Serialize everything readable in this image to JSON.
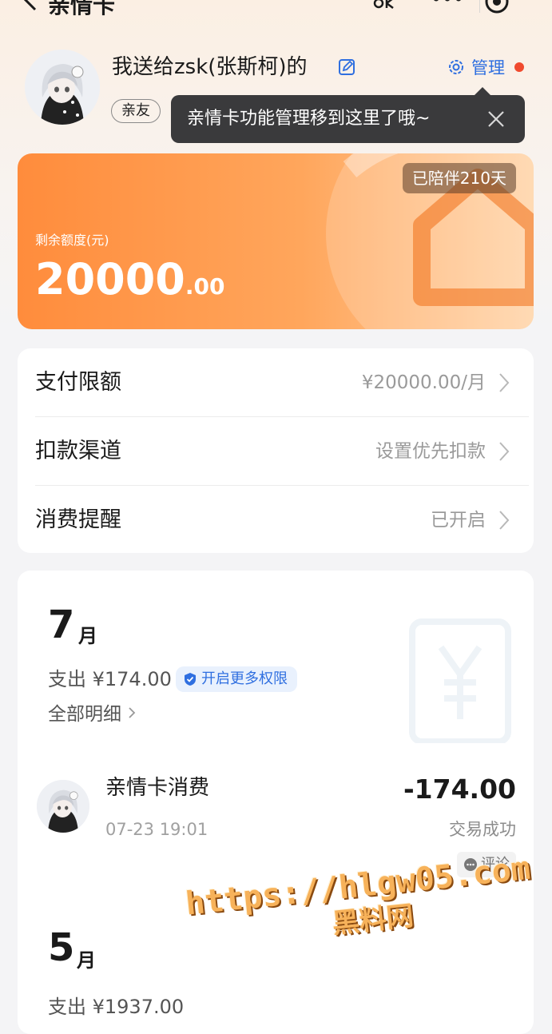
{
  "nav": {
    "title": "亲情卡"
  },
  "profile": {
    "name": "我送给zsk(张斯柯)的",
    "relation_tag": "亲友",
    "manage_label": "管理"
  },
  "tooltip": {
    "text": "亲情卡功能管理移到这里了哦~"
  },
  "card": {
    "days_label": "已陪伴210天",
    "remaining_label": "剩余额度(元)",
    "remaining_int": "20000",
    "remaining_dec": ".00"
  },
  "settings": [
    {
      "label": "支付限额",
      "value": "¥20000.00/月"
    },
    {
      "label": "扣款渠道",
      "value": "设置优先扣款"
    },
    {
      "label": "消费提醒",
      "value": "已开启"
    }
  ],
  "bills": {
    "months": [
      {
        "month": "7",
        "unit": "月",
        "spend": "支出 ¥174.00"
      },
      {
        "month": "5",
        "unit": "月",
        "spend": "支出 ¥1937.00"
      }
    ],
    "permission_label": "开启更多权限",
    "all_detail_label": "全部明细",
    "transaction": {
      "title": "亲情卡消费",
      "time": "07-23 19:01",
      "amount": "-174.00",
      "status": "交易成功",
      "comment_label": "评论"
    }
  },
  "watermark": {
    "url": "https://hlgw05.com",
    "text": "黑料网"
  },
  "colors": {
    "accent_blue": "#2f6fe0",
    "card_orange": "#ff8c3c",
    "badge_red": "#f04a2e"
  }
}
